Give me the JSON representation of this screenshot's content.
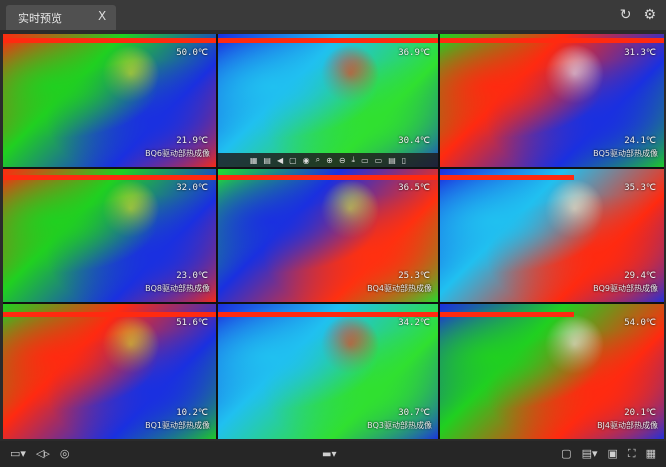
{
  "tab": {
    "title": "实时预览",
    "close_label": "X"
  },
  "header_icons": {
    "refresh": "↻",
    "settings": "⚙"
  },
  "cells": [
    {
      "max": "50.0℃",
      "min": "21.9℃",
      "caption": "BQ6驱动部热成像",
      "colors": [
        "#ff2a10",
        "#20d020",
        "#1a30e0",
        "#e0e020"
      ]
    },
    {
      "max": "36.9℃",
      "min": "30.4℃",
      "caption": "",
      "colors": [
        "#1830e0",
        "#20c0f0",
        "#30e030",
        "#ff3010"
      ]
    },
    {
      "max": "31.3℃",
      "min": "24.1℃",
      "caption": "BQ5驱动部热成像",
      "colors": [
        "#20d020",
        "#ff2a10",
        "#1a30e0",
        "#f0f0f0"
      ]
    },
    {
      "max": "32.0℃",
      "min": "23.0℃",
      "caption": "BQ8驱动部热成像",
      "colors": [
        "#ff2a10",
        "#20d020",
        "#1a30e0",
        "#e0e020"
      ]
    },
    {
      "max": "36.5℃",
      "min": "25.3℃",
      "caption": "BQ4驱动部热成像",
      "colors": [
        "#20e030",
        "#1a30e0",
        "#ff3010",
        "#d0f040"
      ]
    },
    {
      "max": "35.3℃",
      "min": "29.4℃",
      "caption": "BQ9驱动部热成像",
      "colors": [
        "#1a30e0",
        "#20c0f0",
        "#ff2a10",
        "#f8f0d0"
      ]
    },
    {
      "max": "51.6℃",
      "min": "10.2℃",
      "caption": "BQ1驱动部热成像",
      "colors": [
        "#20d020",
        "#ff2a10",
        "#1a30e0",
        "#e0e020"
      ]
    },
    {
      "max": "34.2℃",
      "min": "30.7℃",
      "caption": "BQ3驱动部热成像",
      "colors": [
        "#1a30e0",
        "#20c0f0",
        "#30e030",
        "#ff3010"
      ]
    },
    {
      "max": "54.0℃",
      "min": "20.1℃",
      "caption": "BJ4驱动部热成像",
      "colors": [
        "#1a30e0",
        "#20d020",
        "#ff2a10",
        "#f0f0f0"
      ]
    }
  ],
  "cell_toolbar_icons": [
    "▦",
    "▤",
    "◀",
    "▢",
    "◉",
    "⌕",
    "⊕",
    "⊖",
    "⤓",
    "▭",
    "▭",
    "▤",
    "▯"
  ],
  "bottom_left_icons": [
    "▭▾",
    "◁▹",
    "◎"
  ],
  "bottom_center_icon": "▬▾",
  "bottom_right_icons": [
    "▢",
    "▤▾",
    "▣",
    "⛶",
    "▦"
  ]
}
